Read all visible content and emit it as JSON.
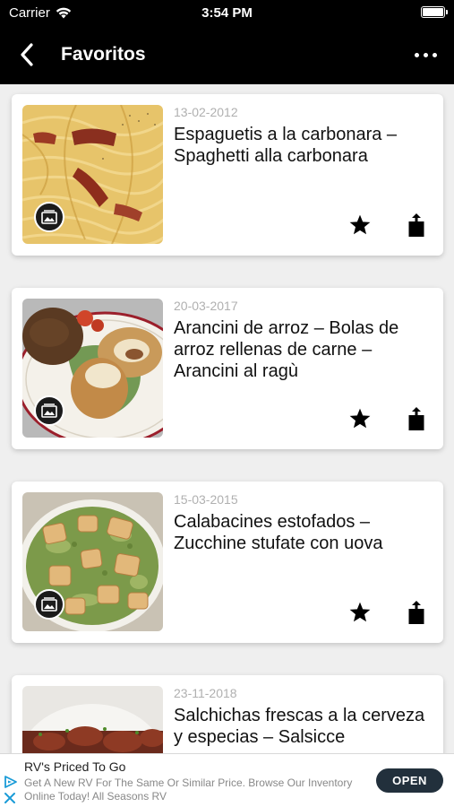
{
  "status": {
    "carrier": "Carrier",
    "time": "3:54 PM"
  },
  "nav": {
    "title": "Favoritos"
  },
  "recipes": [
    {
      "date": "13-02-2012",
      "title": "Espaguetis a la carbonara – Spaghetti alla carbonara"
    },
    {
      "date": "20-03-2017",
      "title": "Arancini de arroz – Bolas de arroz rellenas de carne – Arancini al ragù"
    },
    {
      "date": "15-03-2015",
      "title": "Calabacines estofados – Zucchine stufate con uova"
    },
    {
      "date": "23-11-2018",
      "title": "Salchichas frescas a la cerveza y especias – Salsicce"
    }
  ],
  "ad": {
    "headline": "RV's Priced To Go",
    "body": "Get A New RV For The Same Or Similar Price. Browse Our Inventory Online Today! All Seasons RV",
    "button": "OPEN"
  },
  "colors": {
    "bar": "#000000",
    "background": "#efefef",
    "date": "#b0b0b0",
    "ad_button": "#22303c"
  }
}
